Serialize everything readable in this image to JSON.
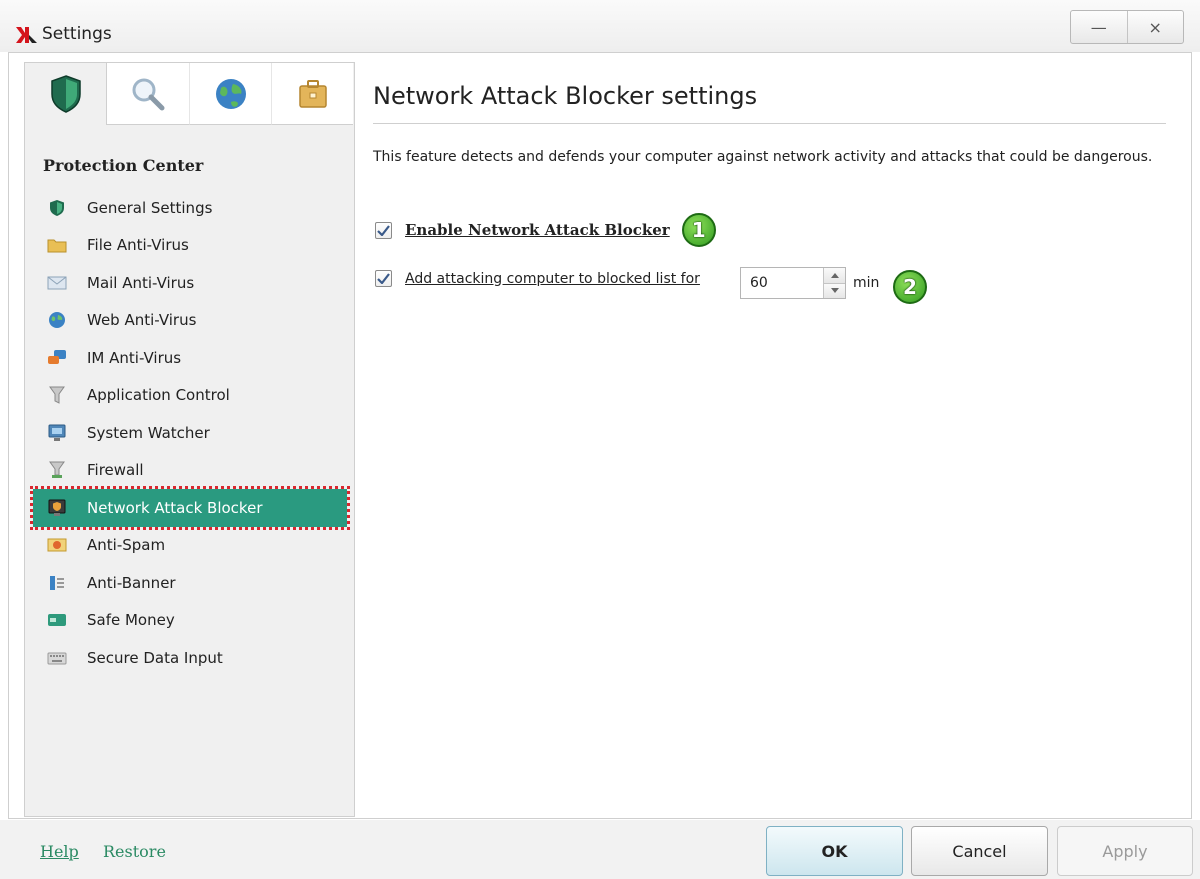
{
  "window": {
    "title": "Settings",
    "minimize_label": "—",
    "close_label": "×"
  },
  "tabs": [
    {
      "icon": "shield-icon",
      "active": true
    },
    {
      "icon": "magnifier-icon",
      "active": false
    },
    {
      "icon": "globe-icon",
      "active": false
    },
    {
      "icon": "briefcase-icon",
      "active": false
    }
  ],
  "sidebar": {
    "section_title": "Protection Center",
    "items": [
      {
        "label": "General Settings",
        "icon": "shield-icon"
      },
      {
        "label": "File Anti-Virus",
        "icon": "folder-icon"
      },
      {
        "label": "Mail Anti-Virus",
        "icon": "envelope-icon"
      },
      {
        "label": "Web Anti-Virus",
        "icon": "globe-icon"
      },
      {
        "label": "IM Anti-Virus",
        "icon": "chat-icon"
      },
      {
        "label": "Application Control",
        "icon": "funnel-icon"
      },
      {
        "label": "System Watcher",
        "icon": "monitor-icon"
      },
      {
        "label": "Firewall",
        "icon": "firewall-icon"
      },
      {
        "label": "Network Attack Blocker",
        "icon": "network-shield-icon",
        "selected": true
      },
      {
        "label": "Anti-Spam",
        "icon": "spam-icon"
      },
      {
        "label": "Anti-Banner",
        "icon": "banner-icon"
      },
      {
        "label": "Safe Money",
        "icon": "card-icon"
      },
      {
        "label": "Secure Data Input",
        "icon": "keyboard-icon"
      }
    ]
  },
  "main": {
    "heading": "Network Attack Blocker settings",
    "description": "This feature detects and defends your computer against network activity and attacks that could be dangerous.",
    "enable_checkbox": {
      "label": "Enable Network Attack Blocker",
      "checked": true,
      "badge": "1"
    },
    "block_checkbox": {
      "label": "Add attacking computer to blocked list for",
      "checked": true,
      "value": "60",
      "unit": "min",
      "badge": "2"
    }
  },
  "footer": {
    "help_label": "Help",
    "restore_label": "Restore",
    "ok_label": "OK",
    "cancel_label": "Cancel",
    "apply_label": "Apply"
  },
  "colors": {
    "selected_bg": "#2a9a80",
    "selected_outline": "#d9272e",
    "link": "#2a8a63",
    "badge_green": "#3aa52a"
  }
}
